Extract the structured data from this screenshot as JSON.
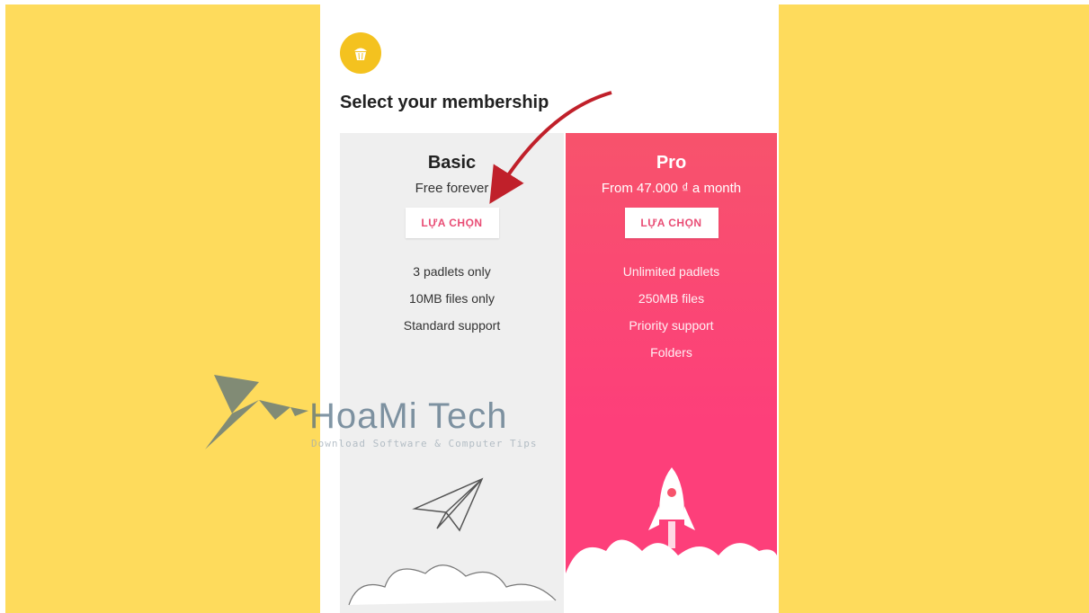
{
  "page": {
    "title": "Select your membership"
  },
  "plans": [
    {
      "name": "Basic",
      "price": "Free forever",
      "button_label": "LỰA CHỌN",
      "features": [
        "3 padlets only",
        "10MB files only",
        "Standard support"
      ]
    },
    {
      "name": "Pro",
      "price": "From 47.000 ₫ a month",
      "button_label": "LỰA CHỌN",
      "features": [
        "Unlimited padlets",
        "250MB files",
        "Priority support",
        "Folders"
      ]
    }
  ],
  "watermark": {
    "brand": "HoaMi Tech",
    "tagline": "Download Software & Computer Tips"
  },
  "colors": {
    "background": "#fedb5c",
    "pro_card": "#fd3f7a",
    "basic_card": "#efefef",
    "logo": "#f4c21f",
    "annotation_arrow": "#c0202a"
  },
  "icons": {
    "app_logo": "cupcake-icon",
    "basic_art": "paper-plane-icon",
    "pro_art": "rocket-icon"
  }
}
